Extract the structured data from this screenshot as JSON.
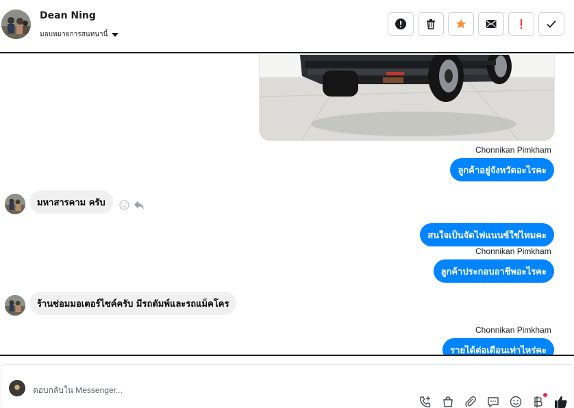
{
  "header": {
    "contact_name": "Dean Ning",
    "assign_label": "มอบหมายการสนทนานี้",
    "actions": [
      {
        "name": "report-button",
        "icon": "alert-circle-icon"
      },
      {
        "name": "delete-button",
        "icon": "trash-icon"
      },
      {
        "name": "star-button",
        "icon": "star-icon"
      },
      {
        "name": "mark-unread-button",
        "icon": "envelope-icon"
      },
      {
        "name": "spam-button",
        "icon": "exclamation-icon"
      },
      {
        "name": "done-button",
        "icon": "check-icon"
      }
    ]
  },
  "messages": {
    "sender1": "Chonnikan Pimkham",
    "out1": "ลูกค้าอยู่จังหวัดอะไรคะ",
    "in1": "มหาสารคาม ครับ",
    "out2": "สนใจเป็นจัดไฟแนนซ์ใช่ไหมคะ",
    "sender2": "Chonnikan Pimkham",
    "out3": "ลูกค้าประกอบอาชีพอะไรคะ",
    "in2": "ร้านซ่อมมอเตอร์ไซค์ครับ มีรถดัมพ์และรถแม็คโคร",
    "sender3": "Chonnikan Pimkham",
    "out4": "รายได้ต่อเดือนเท่าไหร่คะ"
  },
  "composer": {
    "placeholder": "ตอบกลับใน Messenger..."
  },
  "colors": {
    "outgoing_bubble": "#0084ff",
    "incoming_bubble": "#f0f0f0",
    "star": "#f7923a",
    "spam": "#fa383e",
    "notification_dot": "#f02849"
  }
}
